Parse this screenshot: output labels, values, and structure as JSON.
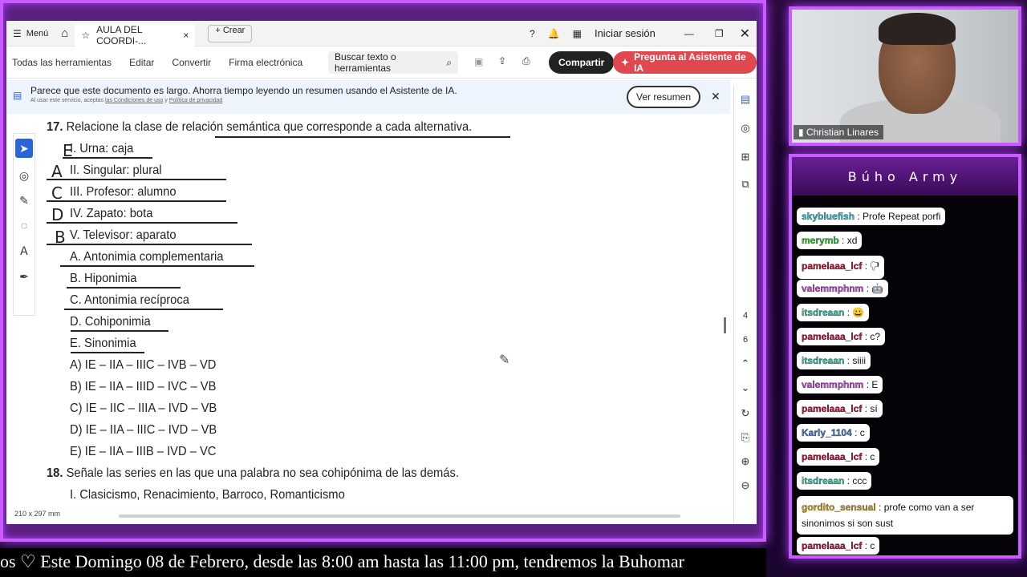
{
  "titlebar": {
    "menu_label": "Menú",
    "tab_label": "AULA DEL COORDI-...",
    "create_label": "Crear",
    "signin_label": "Iniciar sesión"
  },
  "toolbar": {
    "links": [
      "Todas las herramientas",
      "Editar",
      "Convertir",
      "Firma electrónica"
    ],
    "search_label": "Buscar texto o herramientas",
    "share_label": "Compartir",
    "ai_label": "Pregunta al Asistente de IA"
  },
  "banner": {
    "text": "Parece que este documento es largo. Ahorra tiempo leyendo un resumen usando el Asistente de IA.",
    "subtext_prefix": "Al usar este servicio, aceptas ",
    "subtext_link1": "las Condiciones de uso",
    "subtext_mid": " y ",
    "subtext_link2": "Política de privacidad",
    "summary_label": "Ver resumen"
  },
  "right_tools": {
    "page_current": "4",
    "page_total": "6"
  },
  "document": {
    "q17_num": "17.",
    "q17_text": "Relacione la clase de relación semántica que corresponde a cada alternativa.",
    "items": [
      "I. Urna: caja",
      "II. Singular: plural",
      "III. Profesor: alumno",
      "IV. Zapato: bota",
      "V. Televisor: aparato"
    ],
    "types": [
      "A. Antonimia complementaria",
      "B. Hiponimia",
      "C. Antonimia recíproca",
      "D. Cohiponimia",
      "E. Sinonimia"
    ],
    "options": [
      "A) IE – IIA – IIIC – IVB – VD",
      "B) IE – IIA – IIID – IVC – VB",
      "C) IE – IIC – IIIA – IVD – VB",
      "D) IE – IIA – IIIC – IVD – VB",
      "E) IE – IIA – IIIB – IVD – VC"
    ],
    "q18_num": "18.",
    "q18_text": "Señale las series en las que una palabra no sea cohipónima de las demás.",
    "q18_item1": "I. Clasicismo, Renacimiento, Barroco, Romanticismo",
    "handwritten": [
      "E",
      "A",
      "C",
      "D",
      "B"
    ]
  },
  "status": {
    "page_size": "210 x 297 mm"
  },
  "webcam": {
    "name": "Christian Linares"
  },
  "chat": {
    "title": "Búho Army",
    "messages": [
      {
        "user": "skybluefish",
        "text": "Profe Repeat porfi",
        "color": "#36c0c8"
      },
      {
        "user": "merymb",
        "text": "xd",
        "color": "#37c837"
      },
      {
        "user": "pamelaaa_lcf",
        "text": "🖓",
        "color": "#b8183c"
      },
      {
        "user": "valemmphnm",
        "text": "🤖",
        "color": "#c04ad0"
      },
      {
        "user": "itsdreaan",
        "text": "😀",
        "color": "#36c0a0"
      },
      {
        "user": "pamelaaa_lcf",
        "text": "c?",
        "color": "#b8183c"
      },
      {
        "user": "itsdreaan",
        "text": "siiii",
        "color": "#36c0a0"
      },
      {
        "user": "valemmphnm",
        "text": "E",
        "color": "#c04ad0"
      },
      {
        "user": "pamelaaa_lcf",
        "text": "sí",
        "color": "#b8183c"
      },
      {
        "user": "Karly_1104",
        "text": "c",
        "color": "#4a78c8"
      },
      {
        "user": "pamelaaa_lcf",
        "text": "c",
        "color": "#b8183c"
      },
      {
        "user": "itsdreaan",
        "text": "ccc",
        "color": "#36c0a0"
      },
      {
        "user": "gordito_sensual",
        "text": "profe como van a ser sinonimos si son sust",
        "color": "#d0a020"
      },
      {
        "user": "pamelaaa_lcf",
        "text": "c",
        "color": "#b8183c"
      }
    ]
  },
  "ticker": {
    "text": "os ♡  Este Domingo 08 de Febrero, desde las 8:00 am hasta las 11:00 pm, tendremos la Buhomar"
  }
}
